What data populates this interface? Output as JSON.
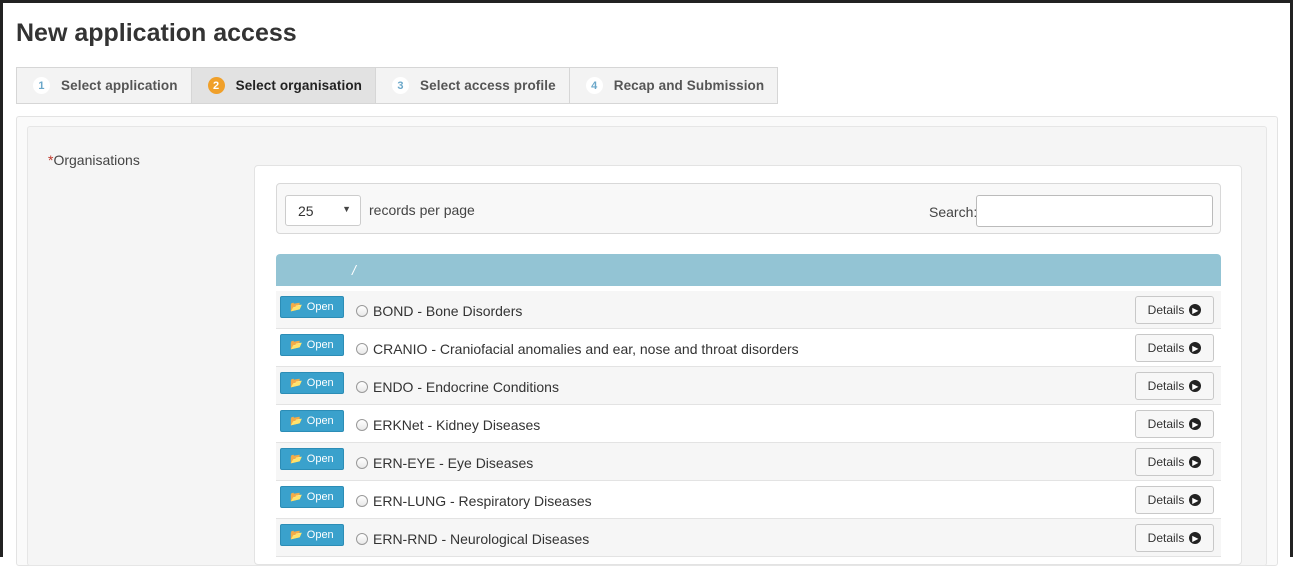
{
  "page": {
    "title": "New application access"
  },
  "steps": [
    {
      "num": "1",
      "label": "Select application",
      "active": false
    },
    {
      "num": "2",
      "label": "Select organisation",
      "active": true
    },
    {
      "num": "3",
      "label": "Select access profile",
      "active": false
    },
    {
      "num": "4",
      "label": "Recap and Submission",
      "active": false
    }
  ],
  "form": {
    "required_mark": "*",
    "field_label": "Organisations"
  },
  "table": {
    "per_page_value": "25",
    "per_page_label": "records per page",
    "search_label": "Search:",
    "search_value": "",
    "header_text": "/",
    "open_label": "Open",
    "details_label": "Details",
    "rows": [
      "BOND - Bone Disorders",
      "CRANIO - Craniofacial anomalies and ear, nose and throat disorders",
      "ENDO - Endocrine Conditions",
      "ERKNet - Kidney Diseases",
      "ERN-EYE - Eye Diseases",
      "ERN-LUNG - Respiratory Diseases",
      "ERN-RND - Neurological Diseases"
    ]
  },
  "colors": {
    "accent": "#3aa1cc",
    "active_step": "#f0a02a",
    "header": "#93c4d4"
  }
}
